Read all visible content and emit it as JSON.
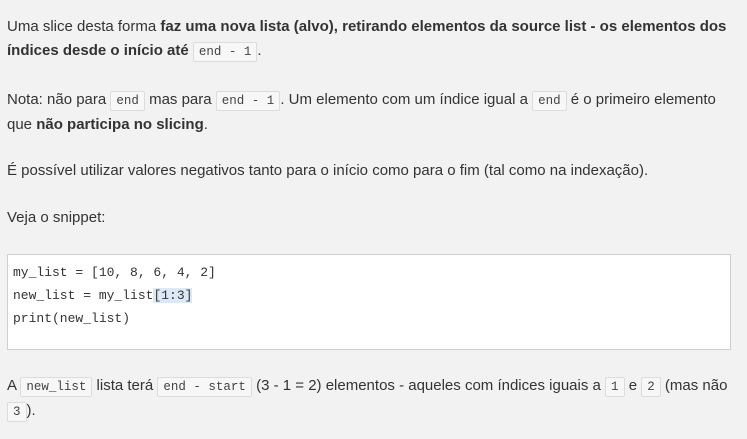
{
  "p1": {
    "t1": "Uma slice desta forma ",
    "b1": "faz uma nova lista (alvo), retirando elementos da source list - os elementos dos índices desde o início até",
    "t2": " ",
    "c1": "end - 1",
    "t3": "."
  },
  "p2": {
    "t1": "Nota: não para ",
    "c1": "end",
    "t2": " mas para ",
    "c2": "end - 1",
    "t3": ". Um elemento com um índice igual a ",
    "c3": "end",
    "t4": " é o primeiro elemento que ",
    "b1": "não participa no slicing",
    "t5": "."
  },
  "p3": "É possível utilizar valores negativos tanto para o início como para o fim (tal como na indexação).",
  "p4": "Veja o snippet:",
  "code": {
    "line1": "my_list = [10, 8, 6, 4, 2]",
    "line2_prefix": "new_list = my_list",
    "line2_hl": "[1:3]",
    "line3": "print(new_list)"
  },
  "p5": {
    "t1": "A ",
    "c1": "new_list",
    "t2": " lista terá ",
    "c2": "end - start",
    "t3": " (3 - 1 = 2) elementos - aqueles com índices iguais a ",
    "c3": "1",
    "t4": " e ",
    "c4": "2",
    "t5": " (mas não ",
    "c5": "3",
    "t6": ")."
  }
}
